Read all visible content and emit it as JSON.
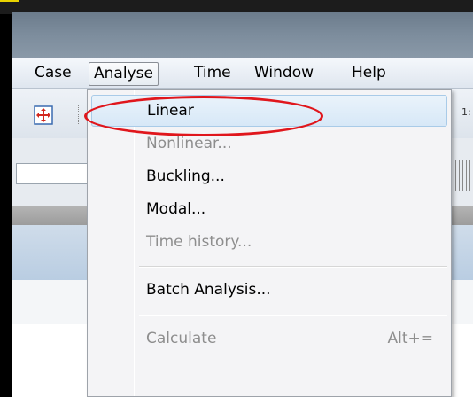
{
  "menubar": {
    "items": [
      {
        "label": "Case"
      },
      {
        "label": "Analyse"
      },
      {
        "label": "Time"
      },
      {
        "label": "Window"
      },
      {
        "label": "Help"
      }
    ]
  },
  "toolbar": {
    "right_fragment": "1:"
  },
  "analyse_menu": {
    "items": [
      {
        "label": "Linear",
        "enabled": true,
        "highlighted": true
      },
      {
        "label": "Nonlinear...",
        "enabled": false
      },
      {
        "label": "Buckling...",
        "enabled": true
      },
      {
        "label": "Modal...",
        "enabled": true
      },
      {
        "label": "Time history...",
        "enabled": false
      },
      {
        "label": "Batch Analysis...",
        "enabled": true
      },
      {
        "label": "Calculate",
        "enabled": false,
        "shortcut": "Alt+="
      }
    ]
  },
  "colors": {
    "annotation_circle": "#e0161c",
    "highlight_bg": "#d7e8f7",
    "disabled_text": "#8e8e8e"
  }
}
